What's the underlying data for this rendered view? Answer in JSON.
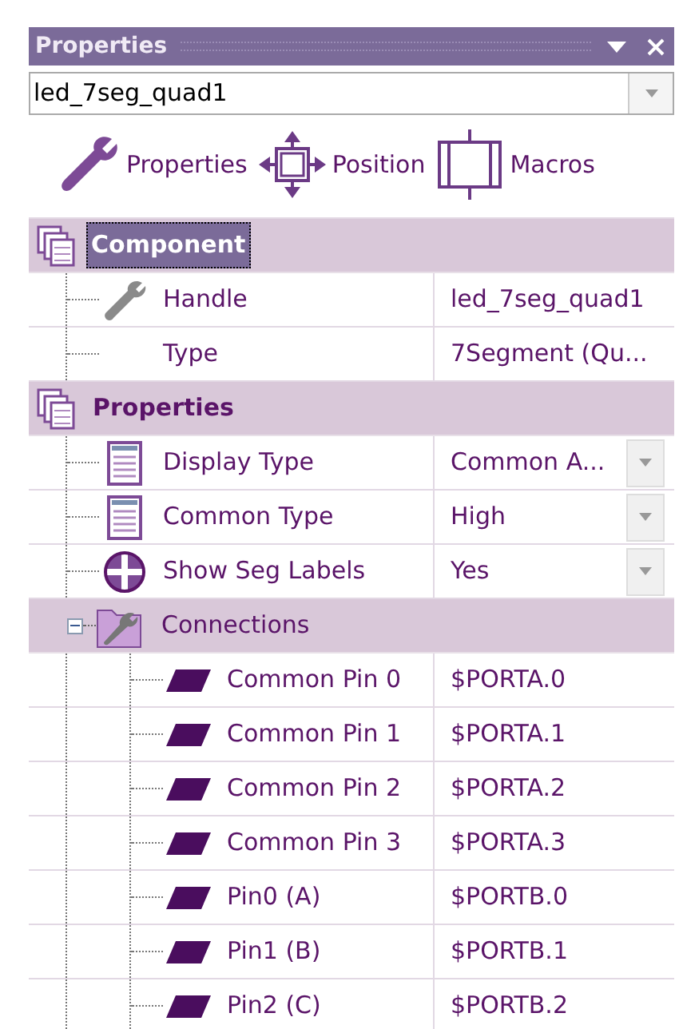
{
  "panel": {
    "title": "Properties"
  },
  "selector": {
    "value": "led_7seg_quad1"
  },
  "toolbar": [
    {
      "label": "Properties",
      "kind": "wrench"
    },
    {
      "label": "Position",
      "kind": "move"
    },
    {
      "label": "Macros",
      "kind": "macro"
    }
  ],
  "groups": [
    {
      "title": "Component",
      "kind": "category",
      "selected": true,
      "rows": [
        {
          "name": "Handle",
          "value": "led_7seg_quad1",
          "kind": "wrench",
          "dropdown": false
        },
        {
          "name": "Type",
          "value": "7Segment (Qu...",
          "kind": "plain",
          "dropdown": false
        }
      ]
    },
    {
      "title": "Properties",
      "kind": "category",
      "selected": false,
      "rows": [
        {
          "name": "Display Type",
          "value": "Common A...",
          "kind": "list",
          "dropdown": true
        },
        {
          "name": "Common Type",
          "value": "High",
          "kind": "list",
          "dropdown": true
        },
        {
          "name": "Show Seg Labels",
          "value": "Yes",
          "kind": "cross",
          "dropdown": true
        }
      ]
    },
    {
      "title": "Connections",
      "kind": "subcategory",
      "selected": false,
      "expanded": true,
      "rows": [
        {
          "name": "Common Pin 0",
          "value": "$PORTA.0",
          "kind": "pin",
          "dropdown": false
        },
        {
          "name": "Common Pin 1",
          "value": "$PORTA.1",
          "kind": "pin",
          "dropdown": false
        },
        {
          "name": "Common Pin 2",
          "value": "$PORTA.2",
          "kind": "pin",
          "dropdown": false
        },
        {
          "name": "Common Pin 3",
          "value": "$PORTA.3",
          "kind": "pin",
          "dropdown": false
        },
        {
          "name": "Pin0 (A)",
          "value": "$PORTB.0",
          "kind": "pin",
          "dropdown": false
        },
        {
          "name": "Pin1 (B)",
          "value": "$PORTB.1",
          "kind": "pin",
          "dropdown": false
        },
        {
          "name": "Pin2 (C)",
          "value": "$PORTB.2",
          "kind": "pin",
          "dropdown": false
        }
      ]
    }
  ]
}
